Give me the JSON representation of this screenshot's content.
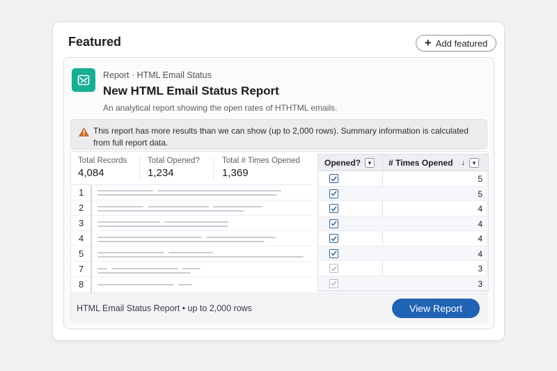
{
  "featured": {
    "title": "Featured",
    "add_button_label": "Add featured"
  },
  "report": {
    "eyebrow": "Report · HTML Email Status",
    "title": "New HTML Email Status Report",
    "description": "An analytical report showing the open rates of HTHTML emails.",
    "warning": "This report has more results than we can show (up to 2,000 rows). Summary information is calculated from full report data.",
    "stats": [
      {
        "label": "Total Records",
        "value": "4,084"
      },
      {
        "label": "Total Opened?",
        "value": "1,234"
      },
      {
        "label": "Total # Times Opened",
        "value": "1,369"
      }
    ],
    "preview_row_numbers": [
      "1",
      "2",
      "3",
      "4",
      "5",
      "7",
      "8"
    ],
    "table": {
      "columns": [
        "Opened?",
        "# Times Opened"
      ],
      "sort_indicator": "↓",
      "rows": [
        {
          "opened": true,
          "times": "5"
        },
        {
          "opened": true,
          "times": "5"
        },
        {
          "opened": true,
          "times": "4"
        },
        {
          "opened": true,
          "times": "4"
        },
        {
          "opened": true,
          "times": "4"
        },
        {
          "opened": true,
          "times": "4"
        },
        {
          "opened": true,
          "times": "3"
        },
        {
          "opened": true,
          "times": "3"
        }
      ]
    },
    "footer_text": "HTML Email Status Report • up to 2,000 rows",
    "view_button_label": "View Report"
  },
  "colors": {
    "icon_tile": "#18ae94",
    "primary_button": "#2062b3",
    "warning_icon": "#c46b2a"
  },
  "icons": {
    "add": "plus-icon",
    "report": "email-report-icon",
    "warning": "warning-icon",
    "checkbox": "checkbox-checked-icon",
    "column_menu": "chevron-down-icon"
  }
}
